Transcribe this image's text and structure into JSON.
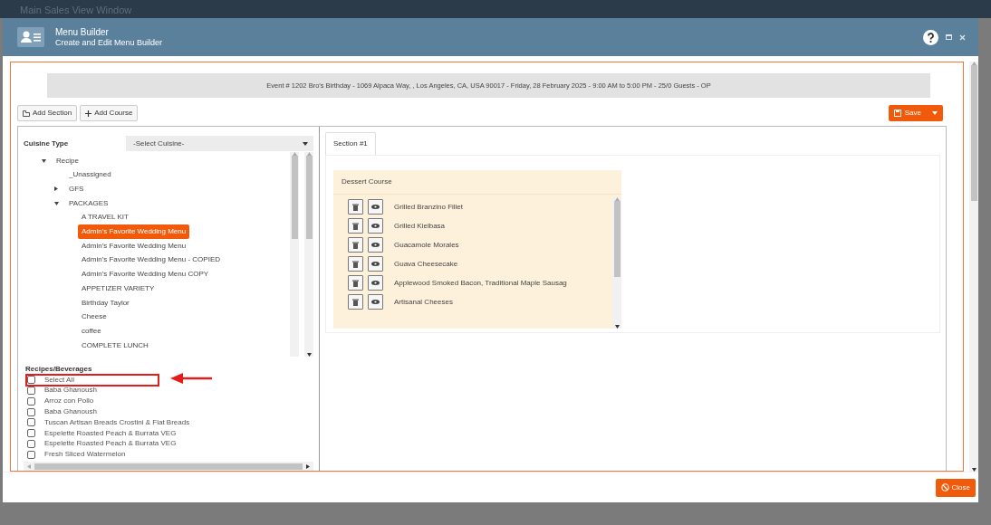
{
  "window": {
    "title": "Main Sales View Window"
  },
  "dialog": {
    "title": "Menu Builder",
    "subtitle": "Create and Edit Menu Builder"
  },
  "event_banner": "Event # 1202 Bro's Birthday - 1069 Alpaca Way, , Los Angeles, CA, USA 90017 - Friday, 28 February 2025 - 9:00 AM to 5:00 PM - 25/0 Guests - OP",
  "toolbar": {
    "buttons": [
      {
        "label": "Add Section",
        "kind": "section"
      },
      {
        "label": "Add Course",
        "kind": "plus"
      }
    ],
    "save": "Save"
  },
  "cuisine": {
    "label": "Cuisine Type",
    "value": "-Select Cuisine-"
  },
  "tree": [
    {
      "label": "Recipe",
      "kind": "folder",
      "expanded": true,
      "selected": false,
      "children": [
        {
          "label": "_Unassigned",
          "kind": "leaf",
          "selected": false
        },
        {
          "label": "GFS",
          "kind": "folder",
          "expanded": false,
          "selected": false
        },
        {
          "label": "PACKAGES",
          "kind": "folder",
          "expanded": true,
          "selected": false,
          "children": [
            {
              "label": "A TRAVEL KIT",
              "kind": "leaf",
              "selected": false
            },
            {
              "label": "Admin's Favorite Wedding Menu",
              "kind": "leaf",
              "selected": true
            },
            {
              "label": "Admin's Favorite Wedding Menu",
              "kind": "leaf",
              "selected": false
            },
            {
              "label": "Admin's Favorite Wedding Menu - COPIED",
              "kind": "leaf",
              "selected": false
            },
            {
              "label": "Admin's Favorite Wedding Menu COPY",
              "kind": "leaf",
              "selected": false
            },
            {
              "label": "APPETIZER VARIETY",
              "kind": "leaf",
              "selected": false
            },
            {
              "label": "Birthday Taylor",
              "kind": "leaf",
              "selected": false
            },
            {
              "label": "Cheese",
              "kind": "leaf",
              "selected": false
            },
            {
              "label": "coffee",
              "kind": "leaf",
              "selected": false
            },
            {
              "label": "COMPLETE LUNCH",
              "kind": "leaf",
              "selected": false
            }
          ]
        }
      ]
    }
  ],
  "recipes": {
    "heading": "Recipes/Beverages",
    "items": [
      {
        "label": "Select All",
        "checked": false,
        "highlighted": true
      },
      {
        "label": "Baba Ghanoush",
        "checked": false,
        "highlighted": false
      },
      {
        "label": "Arroz con Pollo",
        "checked": false,
        "highlighted": false
      },
      {
        "label": "Baba Ghanoush",
        "checked": false,
        "highlighted": false
      },
      {
        "label": "Tuscan Artisan Breads Crostini & Flat Breads",
        "checked": false,
        "highlighted": false
      },
      {
        "label": "Espelette Roasted Peach & Burrata VEG",
        "checked": false,
        "highlighted": false
      },
      {
        "label": "Espelette Roasted Peach & Burrata VEG",
        "checked": false,
        "highlighted": false
      },
      {
        "label": "Fresh Sliced Watermelon",
        "checked": false,
        "highlighted": false
      }
    ]
  },
  "tabs": [
    {
      "label": "Section #1",
      "selected": true
    }
  ],
  "course": {
    "title": "Dessert Course",
    "items": [
      "Grilled Branzino Fillet",
      "Grilled Kielbasa",
      "Guacamole Morales",
      "Guava Cheesecake",
      "Applewood Smoked Bacon, Traditional Maple Sausag",
      "Artisanal Cheeses"
    ]
  },
  "footer": {
    "close": "Close"
  }
}
